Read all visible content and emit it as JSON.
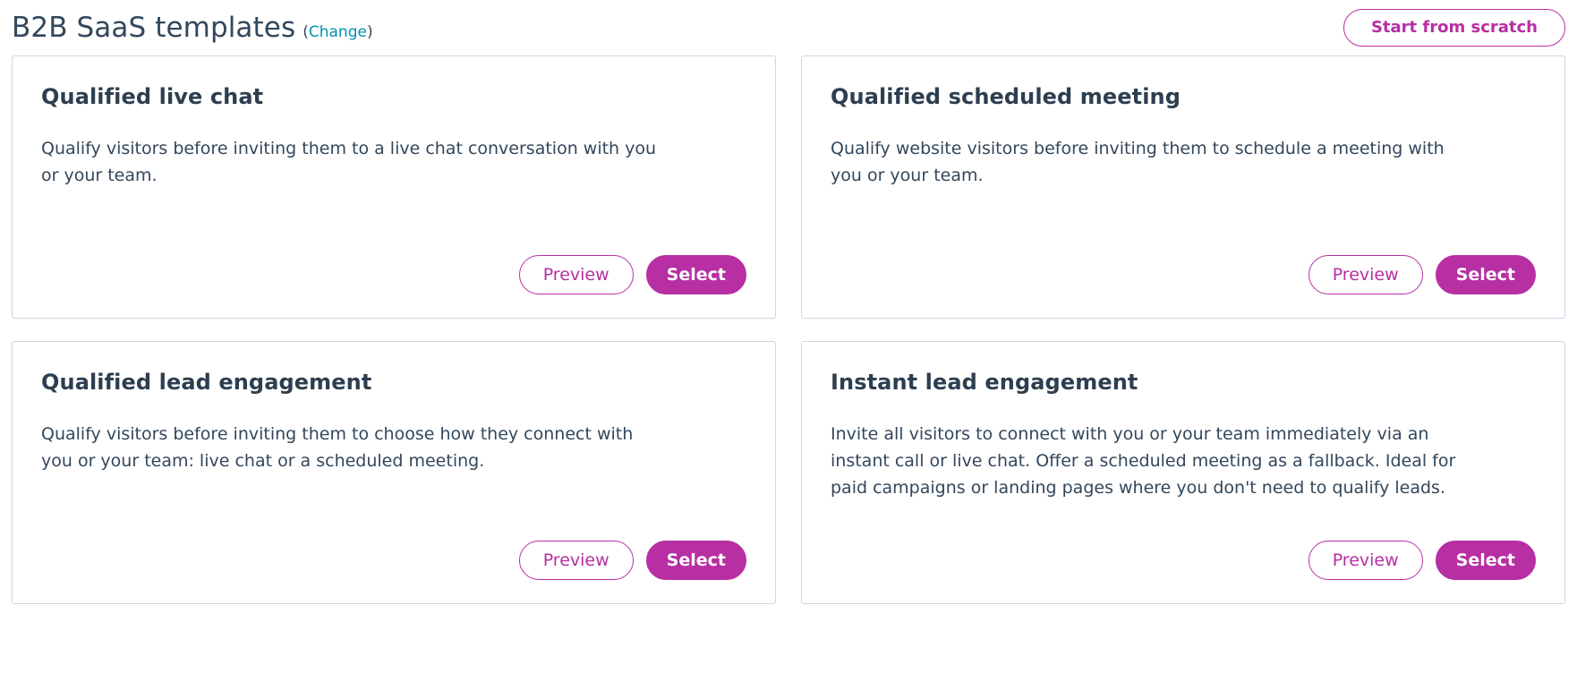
{
  "header": {
    "title": "B2B SaaS templates",
    "change_prefix": "(",
    "change_label": "Change",
    "change_suffix": ")",
    "start_from_scratch_label": "Start from scratch"
  },
  "actions": {
    "preview_label": "Preview",
    "select_label": "Select"
  },
  "colors": {
    "accent": "#b72fa3",
    "link": "#0091ae",
    "text": "#33475b",
    "card_border": "#cbd6e2"
  },
  "cards": [
    {
      "title": "Qualified live chat",
      "description": "Qualify visitors before inviting them to a live chat conversation with you or your team.",
      "preview_label": "Preview",
      "select_label": "Select"
    },
    {
      "title": "Qualified scheduled meeting",
      "description": "Qualify website visitors before inviting them to schedule a meeting with you or your team.",
      "preview_label": "Preview",
      "select_label": "Select"
    },
    {
      "title": "Qualified lead engagement",
      "description": "Qualify visitors before inviting them to choose how they connect with you or your team: live chat or a scheduled meeting.",
      "preview_label": "Preview",
      "select_label": "Select"
    },
    {
      "title": "Instant lead engagement",
      "description": "Invite all visitors to connect with you or your team immediately via an instant call or live chat. Offer a scheduled meeting as a fallback. Ideal for paid campaigns or landing pages where you don't need to qualify leads.",
      "preview_label": "Preview",
      "select_label": "Select"
    }
  ]
}
